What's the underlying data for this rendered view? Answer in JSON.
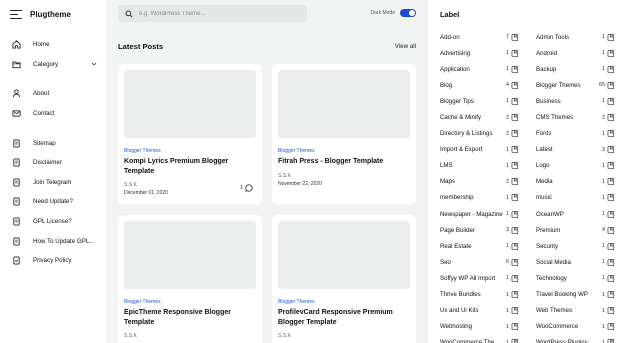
{
  "app": {
    "brand": "Plugtheme"
  },
  "nav": [
    {
      "label": "Home",
      "icon": "home-icon"
    },
    {
      "label": "Category",
      "icon": "folder-icon",
      "expandable": true
    },
    {
      "label": "About",
      "icon": "user-icon"
    },
    {
      "label": "Contact",
      "icon": "mail-icon"
    },
    {
      "label": "Sitemap",
      "icon": "page-icon"
    },
    {
      "label": "Disclaimer",
      "icon": "page-icon"
    },
    {
      "label": "Join Telegram",
      "icon": "page-icon"
    },
    {
      "label": "Need Update?",
      "icon": "page-icon"
    },
    {
      "label": "GPL License?",
      "icon": "page-icon"
    },
    {
      "label": "How To Update GPL...",
      "icon": "page-icon"
    },
    {
      "label": "Privacy Policy",
      "icon": "page-check-icon"
    }
  ],
  "search": {
    "placeholder": "e.g. WordPress Theme..."
  },
  "dark_mode": {
    "label": "Dark Mode",
    "on": true
  },
  "section": {
    "title": "Latest Posts",
    "view_all": "View all"
  },
  "posts": [
    {
      "category": "Blogger Themes",
      "title": "Kompi Lyrics Premium Blogger Template",
      "author": "S.S.K",
      "date": "December 01, 2020",
      "comments": "1"
    },
    {
      "category": "Blogger Themes",
      "title": "Fitrah Press - Blogger Template",
      "author": "S.S.K",
      "date": "November 22, 2020",
      "comments": ""
    },
    {
      "category": "Blogger Themes",
      "title": "EpicTheme Responsive Blogger Template",
      "author": "S.S.K",
      "date": "",
      "comments": ""
    },
    {
      "category": "Blogger Themes",
      "title": "ProfilevCard Responsive Premium Blogger Template",
      "author": "S.S.K",
      "date": "",
      "comments": ""
    }
  ],
  "labels": {
    "title": "Label",
    "left": [
      {
        "name": "Add-on",
        "count": "7"
      },
      {
        "name": "Advertising",
        "count": "1"
      },
      {
        "name": "Application",
        "count": "1"
      },
      {
        "name": "Blog",
        "count": "4"
      },
      {
        "name": "Blogger Tips",
        "count": "1"
      },
      {
        "name": "Cache & Minify",
        "count": "2"
      },
      {
        "name": "Directory & Listings",
        "count": "2"
      },
      {
        "name": "Import & Export",
        "count": "1"
      },
      {
        "name": "LMS",
        "count": "1"
      },
      {
        "name": "Maps",
        "count": "2"
      },
      {
        "name": "membership",
        "count": "1"
      },
      {
        "name": "Newspaper - Magazine",
        "count": "1"
      },
      {
        "name": "Page Builder",
        "count": "3"
      },
      {
        "name": "Real Estate",
        "count": "1"
      },
      {
        "name": "Seo",
        "count": "6"
      },
      {
        "name": "Soffyy WP All Import",
        "count": "1"
      },
      {
        "name": "Thrive Bundles",
        "count": "1"
      },
      {
        "name": "Ux and Ui Kits",
        "count": "1"
      },
      {
        "name": "Webhosting",
        "count": "1"
      },
      {
        "name": "WooCommerce Themes",
        "count": "1"
      }
    ],
    "right": [
      {
        "name": "Admin Tools",
        "count": "1"
      },
      {
        "name": "Android",
        "count": "1"
      },
      {
        "name": "Backup",
        "count": "1"
      },
      {
        "name": "Blogger Themes",
        "count": "65"
      },
      {
        "name": "Business",
        "count": "1"
      },
      {
        "name": "CMS Themes",
        "count": "2"
      },
      {
        "name": "Fonts",
        "count": "1"
      },
      {
        "name": "Latest",
        "count": "3"
      },
      {
        "name": "Logo",
        "count": "1"
      },
      {
        "name": "Media",
        "count": "1"
      },
      {
        "name": "music",
        "count": "1"
      },
      {
        "name": "OceanWP",
        "count": "1"
      },
      {
        "name": "Premium",
        "count": "4"
      },
      {
        "name": "Security",
        "count": "1"
      },
      {
        "name": "Social Media",
        "count": "1"
      },
      {
        "name": "Technology",
        "count": "1"
      },
      {
        "name": "Travel Booking WP",
        "count": "1"
      },
      {
        "name": "Web Themes",
        "count": "1"
      },
      {
        "name": "WooCommerce",
        "count": "1"
      },
      {
        "name": "WordPress Plugins",
        "count": "1"
      }
    ]
  }
}
